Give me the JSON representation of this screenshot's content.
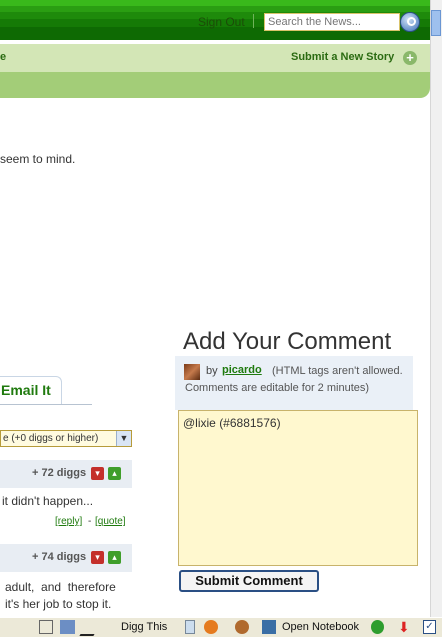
{
  "header": {
    "sign_out": "Sign Out",
    "search_placeholder": "Search the News..."
  },
  "subnav": {
    "left_fragment": "e",
    "submit_story": "Submit a New Story"
  },
  "article": {
    "teaser_fragment": "seem to mind."
  },
  "comment_form": {
    "heading": "Add Your Comment",
    "by_label": "by",
    "username": "picardo",
    "html_note": "(HTML tags aren't allowed.",
    "edit_note": "Comments are editable for 2 minutes)",
    "textarea_value": "@lixie (#6881576)",
    "submit_label": "Submit Comment"
  },
  "comments_panel": {
    "email_tab": "Email It",
    "filter_selected": "e (+0 diggs or higher)",
    "comments": [
      {
        "diggs": "+ 72 diggs",
        "text": "it didn't happen...",
        "reply": "[reply]",
        "separator": "-",
        "quote": "[quote]"
      },
      {
        "diggs": "+ 74 diggs",
        "line1": "adult,  and  therefore",
        "line2": "it's her job to stop it."
      }
    ]
  },
  "statusbar": {
    "digg_this": "Digg This",
    "open_notebook": "Open Notebook"
  },
  "colors": {
    "brand_green": "#1f7a0e",
    "header_green": "#2a9e12",
    "subnav_green": "#d3e6b6",
    "comment_bg": "#fff8cf"
  }
}
